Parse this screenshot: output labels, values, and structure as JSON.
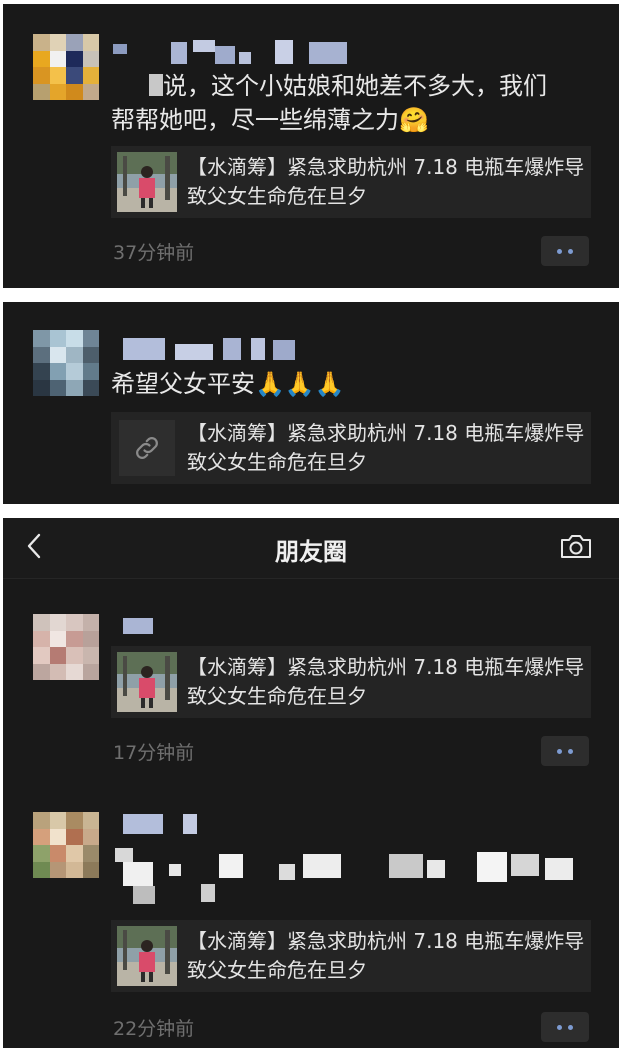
{
  "post1": {
    "text_line1": "说，这个小姑娘和她差不多大，我们",
    "text_line2": "帮帮她吧，尽一些绵薄之力",
    "emoji": "🤗",
    "link_title": "【水滴筹】紧急求助杭州 7.18 电瓶车爆炸导致父女生命危在旦夕",
    "time": "37分钟前"
  },
  "post2": {
    "text": "希望父女平安",
    "emoji": "🙏🙏🙏",
    "link_title": "【水滴筹】紧急求助杭州 7.18 电瓶车爆炸导致父女生命危在旦夕"
  },
  "nav": {
    "title": "朋友圈",
    "back_icon": "back-arrow-icon",
    "camera_icon": "camera-icon"
  },
  "post3": {
    "link_title": "【水滴筹】紧急求助杭州 7.18 电瓶车爆炸导致父女生命危在旦夕",
    "time": "17分钟前"
  },
  "post4": {
    "link_title": "【水滴筹】紧急求助杭州 7.18 电瓶车爆炸导致父女生命危在旦夕",
    "time": "22分钟前"
  },
  "colors": {
    "background": "#191919",
    "card": "#242424",
    "link_accent": "#7d9bd1",
    "muted_text": "#6f6f6f"
  }
}
